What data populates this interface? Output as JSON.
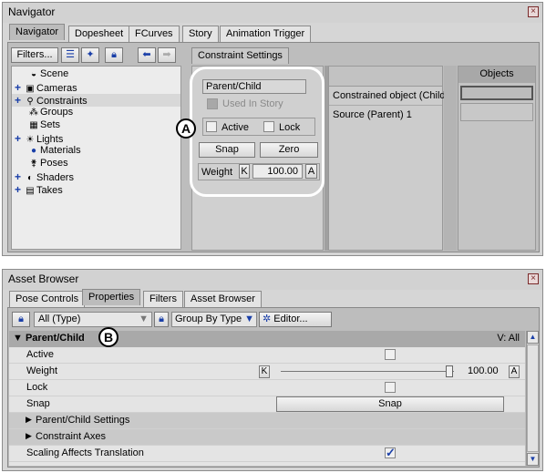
{
  "navigator": {
    "title": "Navigator",
    "tabs": [
      "Navigator",
      "Dopesheet",
      "FCurves",
      "Story",
      "Animation Trigger"
    ],
    "filters_label": "Filters...",
    "tree": [
      "Scene",
      "Cameras",
      "Constraints",
      "Groups",
      "Sets",
      "Lights",
      "Materials",
      "Poses",
      "Shaders",
      "Takes"
    ],
    "constraint_tab": "Constraint Settings",
    "constraint_name": "Parent/Child",
    "used_in_story": "Used In Story",
    "active_label": "Active",
    "lock_label": "Lock",
    "snap_label": "Snap",
    "zero_label": "Zero",
    "weight_label": "Weight",
    "weight_key": "K",
    "weight_value": "100.00",
    "weight_anim": "A",
    "constrained_object": "Constrained object (Child)",
    "source_parent": "Source (Parent) 1",
    "objects_header": "Objects",
    "callout_a": "A"
  },
  "asset_browser": {
    "title": "Asset Browser",
    "tabs": [
      "Pose Controls",
      "Properties",
      "Filters",
      "Asset Browser"
    ],
    "type_filter": "All (Type)",
    "group_by": "Group By Type",
    "editor_label": "Editor...",
    "section_title": "Parent/Child",
    "section_right": "V: All",
    "callout_b": "B",
    "rows": {
      "active": "Active",
      "weight": "Weight",
      "weight_key": "K",
      "weight_value": "100.00",
      "weight_anim": "A",
      "lock": "Lock",
      "snap": "Snap",
      "snap_button": "Snap",
      "pc_settings": "Parent/Child Settings",
      "constraint_axes": "Constraint Axes",
      "scaling": "Scaling Affects Translation"
    }
  }
}
